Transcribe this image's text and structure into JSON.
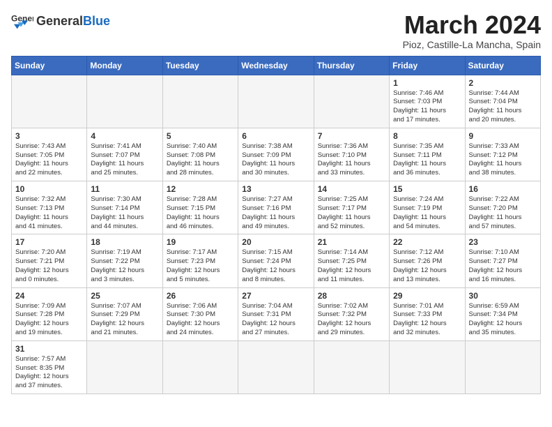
{
  "header": {
    "logo_general": "General",
    "logo_blue": "Blue",
    "month_title": "March 2024",
    "subtitle": "Pioz, Castille-La Mancha, Spain"
  },
  "weekdays": [
    "Sunday",
    "Monday",
    "Tuesday",
    "Wednesday",
    "Thursday",
    "Friday",
    "Saturday"
  ],
  "weeks": [
    [
      {
        "day": "",
        "info": ""
      },
      {
        "day": "",
        "info": ""
      },
      {
        "day": "",
        "info": ""
      },
      {
        "day": "",
        "info": ""
      },
      {
        "day": "",
        "info": ""
      },
      {
        "day": "1",
        "info": "Sunrise: 7:46 AM\nSunset: 7:03 PM\nDaylight: 11 hours\nand 17 minutes."
      },
      {
        "day": "2",
        "info": "Sunrise: 7:44 AM\nSunset: 7:04 PM\nDaylight: 11 hours\nand 20 minutes."
      }
    ],
    [
      {
        "day": "3",
        "info": "Sunrise: 7:43 AM\nSunset: 7:05 PM\nDaylight: 11 hours\nand 22 minutes."
      },
      {
        "day": "4",
        "info": "Sunrise: 7:41 AM\nSunset: 7:07 PM\nDaylight: 11 hours\nand 25 minutes."
      },
      {
        "day": "5",
        "info": "Sunrise: 7:40 AM\nSunset: 7:08 PM\nDaylight: 11 hours\nand 28 minutes."
      },
      {
        "day": "6",
        "info": "Sunrise: 7:38 AM\nSunset: 7:09 PM\nDaylight: 11 hours\nand 30 minutes."
      },
      {
        "day": "7",
        "info": "Sunrise: 7:36 AM\nSunset: 7:10 PM\nDaylight: 11 hours\nand 33 minutes."
      },
      {
        "day": "8",
        "info": "Sunrise: 7:35 AM\nSunset: 7:11 PM\nDaylight: 11 hours\nand 36 minutes."
      },
      {
        "day": "9",
        "info": "Sunrise: 7:33 AM\nSunset: 7:12 PM\nDaylight: 11 hours\nand 38 minutes."
      }
    ],
    [
      {
        "day": "10",
        "info": "Sunrise: 7:32 AM\nSunset: 7:13 PM\nDaylight: 11 hours\nand 41 minutes."
      },
      {
        "day": "11",
        "info": "Sunrise: 7:30 AM\nSunset: 7:14 PM\nDaylight: 11 hours\nand 44 minutes."
      },
      {
        "day": "12",
        "info": "Sunrise: 7:28 AM\nSunset: 7:15 PM\nDaylight: 11 hours\nand 46 minutes."
      },
      {
        "day": "13",
        "info": "Sunrise: 7:27 AM\nSunset: 7:16 PM\nDaylight: 11 hours\nand 49 minutes."
      },
      {
        "day": "14",
        "info": "Sunrise: 7:25 AM\nSunset: 7:17 PM\nDaylight: 11 hours\nand 52 minutes."
      },
      {
        "day": "15",
        "info": "Sunrise: 7:24 AM\nSunset: 7:19 PM\nDaylight: 11 hours\nand 54 minutes."
      },
      {
        "day": "16",
        "info": "Sunrise: 7:22 AM\nSunset: 7:20 PM\nDaylight: 11 hours\nand 57 minutes."
      }
    ],
    [
      {
        "day": "17",
        "info": "Sunrise: 7:20 AM\nSunset: 7:21 PM\nDaylight: 12 hours\nand 0 minutes."
      },
      {
        "day": "18",
        "info": "Sunrise: 7:19 AM\nSunset: 7:22 PM\nDaylight: 12 hours\nand 3 minutes."
      },
      {
        "day": "19",
        "info": "Sunrise: 7:17 AM\nSunset: 7:23 PM\nDaylight: 12 hours\nand 5 minutes."
      },
      {
        "day": "20",
        "info": "Sunrise: 7:15 AM\nSunset: 7:24 PM\nDaylight: 12 hours\nand 8 minutes."
      },
      {
        "day": "21",
        "info": "Sunrise: 7:14 AM\nSunset: 7:25 PM\nDaylight: 12 hours\nand 11 minutes."
      },
      {
        "day": "22",
        "info": "Sunrise: 7:12 AM\nSunset: 7:26 PM\nDaylight: 12 hours\nand 13 minutes."
      },
      {
        "day": "23",
        "info": "Sunrise: 7:10 AM\nSunset: 7:27 PM\nDaylight: 12 hours\nand 16 minutes."
      }
    ],
    [
      {
        "day": "24",
        "info": "Sunrise: 7:09 AM\nSunset: 7:28 PM\nDaylight: 12 hours\nand 19 minutes."
      },
      {
        "day": "25",
        "info": "Sunrise: 7:07 AM\nSunset: 7:29 PM\nDaylight: 12 hours\nand 21 minutes."
      },
      {
        "day": "26",
        "info": "Sunrise: 7:06 AM\nSunset: 7:30 PM\nDaylight: 12 hours\nand 24 minutes."
      },
      {
        "day": "27",
        "info": "Sunrise: 7:04 AM\nSunset: 7:31 PM\nDaylight: 12 hours\nand 27 minutes."
      },
      {
        "day": "28",
        "info": "Sunrise: 7:02 AM\nSunset: 7:32 PM\nDaylight: 12 hours\nand 29 minutes."
      },
      {
        "day": "29",
        "info": "Sunrise: 7:01 AM\nSunset: 7:33 PM\nDaylight: 12 hours\nand 32 minutes."
      },
      {
        "day": "30",
        "info": "Sunrise: 6:59 AM\nSunset: 7:34 PM\nDaylight: 12 hours\nand 35 minutes."
      }
    ],
    [
      {
        "day": "31",
        "info": "Sunrise: 7:57 AM\nSunset: 8:35 PM\nDaylight: 12 hours\nand 37 minutes."
      },
      {
        "day": "",
        "info": ""
      },
      {
        "day": "",
        "info": ""
      },
      {
        "day": "",
        "info": ""
      },
      {
        "day": "",
        "info": ""
      },
      {
        "day": "",
        "info": ""
      },
      {
        "day": "",
        "info": ""
      }
    ]
  ]
}
